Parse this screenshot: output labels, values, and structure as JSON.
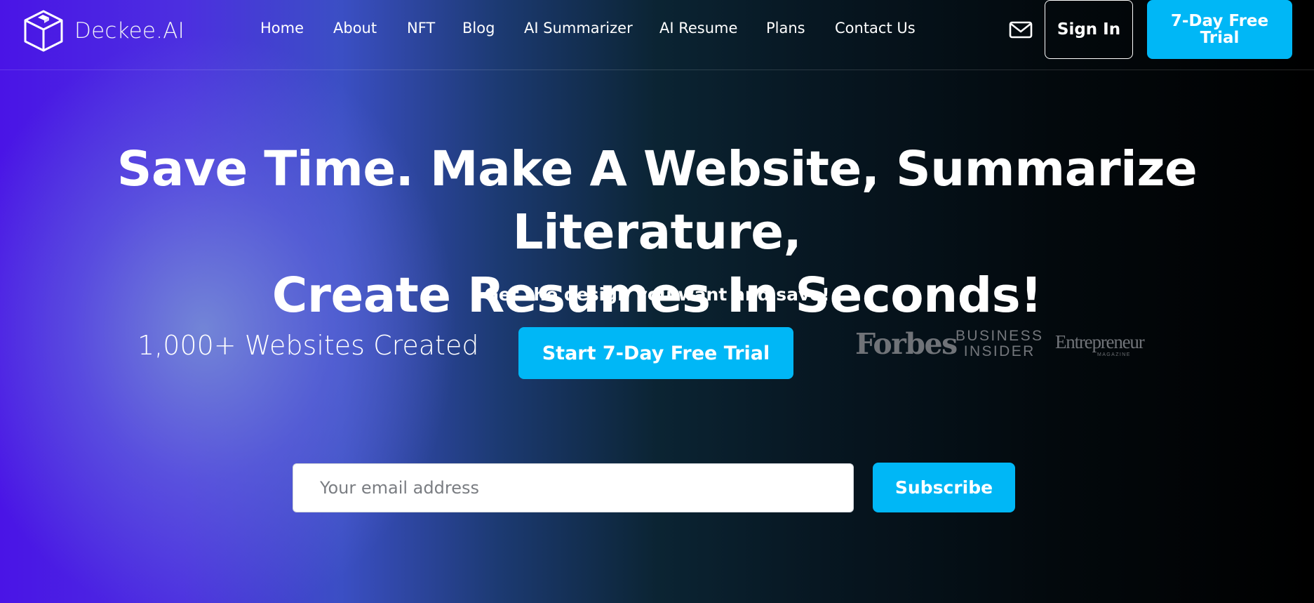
{
  "brand": {
    "name": "Deckee.AI",
    "logo_icon": "cube-logo-icon"
  },
  "nav": {
    "items": [
      {
        "label": "Home"
      },
      {
        "label": "About"
      },
      {
        "label": "NFT"
      },
      {
        "label": "Blog"
      },
      {
        "label": "AI Summarizer"
      },
      {
        "label": "AI Resume"
      },
      {
        "label": "Plans"
      },
      {
        "label": "Contact Us"
      }
    ],
    "mail_icon": "mail-icon",
    "signin_label": "Sign In",
    "trial_label": "7-Day Free Trial"
  },
  "hero": {
    "title_line1": "Save Time. Make A Website, Summarize Literature,",
    "title_line2": "Create Resumes In Seconds!",
    "subtitle": "Get the design you want and save!",
    "stat": "1,000+ Websites Created",
    "cta_label": "Start 7-Day Free Trial"
  },
  "press": {
    "forbes": "Forbes",
    "business_insider_line1": "BUSINESS",
    "business_insider_line2": "INSIDER",
    "entrepreneur": "Entrepreneur",
    "entrepreneur_sub": "MAGAZINE"
  },
  "subscribe": {
    "placeholder": "Your email address",
    "value": "",
    "button_label": "Subscribe"
  },
  "colors": {
    "accent": "#00b7f6",
    "background_dark": "#000000",
    "gradient_purple": "#4a14e6",
    "text": "#ffffff"
  }
}
